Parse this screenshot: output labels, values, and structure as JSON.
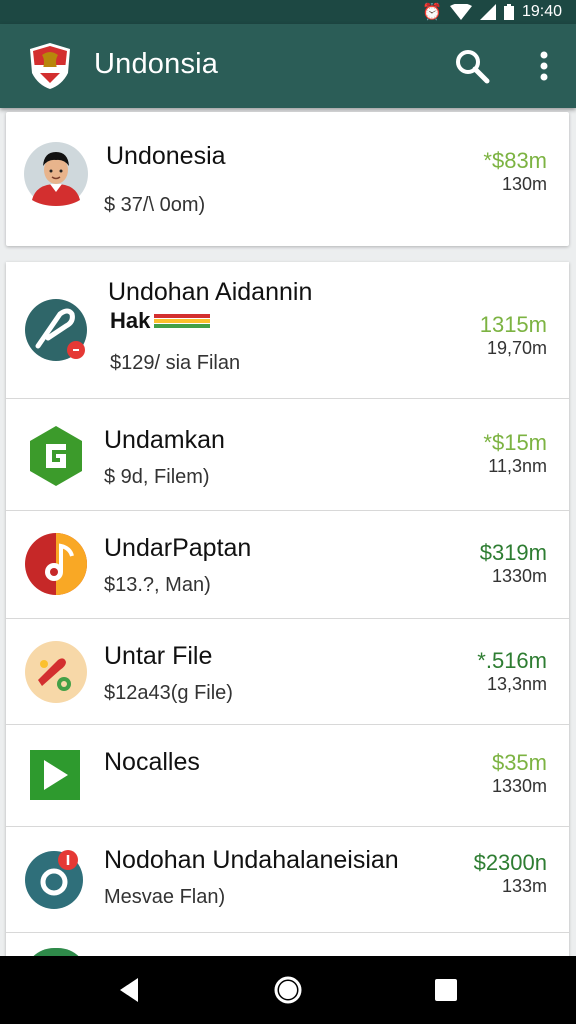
{
  "status_bar": {
    "time": "19:40"
  },
  "app_bar": {
    "title": "Undonsia"
  },
  "colors": {
    "app_bar": "#2b5d57",
    "status_bar": "#1d4843",
    "price_green": "#7cb342",
    "price_dark_green": "#2e7d32"
  },
  "featured": {
    "name": "Undonesia",
    "sub": "$ 37/\\ 0om)",
    "price": "*$83m",
    "amount": "130m",
    "icon": "person-avatar-icon"
  },
  "items": [
    {
      "name": "Undohan Aidannin",
      "tag": "Hak",
      "sub": "$129/ sia Filan",
      "price": "1315m",
      "amount": "19,70m",
      "icon": "teal-circle-app-icon",
      "price_color": "#7cb342"
    },
    {
      "name": "Undamkan",
      "sub": "$ 9d, Filem)",
      "price": "*$15m",
      "amount": "11,3nm",
      "icon": "green-hexagon-app-icon",
      "price_color": "#7cb342"
    },
    {
      "name": "UndarPaptan",
      "sub": "$13.?, Man)",
      "price": "$319m",
      "amount": "1330m",
      "icon": "music-note-icon",
      "price_color": "#2e7d32"
    },
    {
      "name": "Untar File",
      "sub": "$12a43(g File)",
      "price": "*.516m",
      "amount": "13,3nm",
      "icon": "paint-palette-icon",
      "price_color": "#2e7d32"
    },
    {
      "name": "Nocalles",
      "sub": "",
      "price": "$35m",
      "amount": "1330m",
      "icon": "play-arrow-icon",
      "price_color": "#7cb342"
    },
    {
      "name": "Nodohan Undahalaneisian",
      "sub": "Mesvae Flan)",
      "price": "$2300n",
      "amount": "133m",
      "icon": "notification-circle-icon",
      "price_color": "#2e7d32"
    }
  ]
}
